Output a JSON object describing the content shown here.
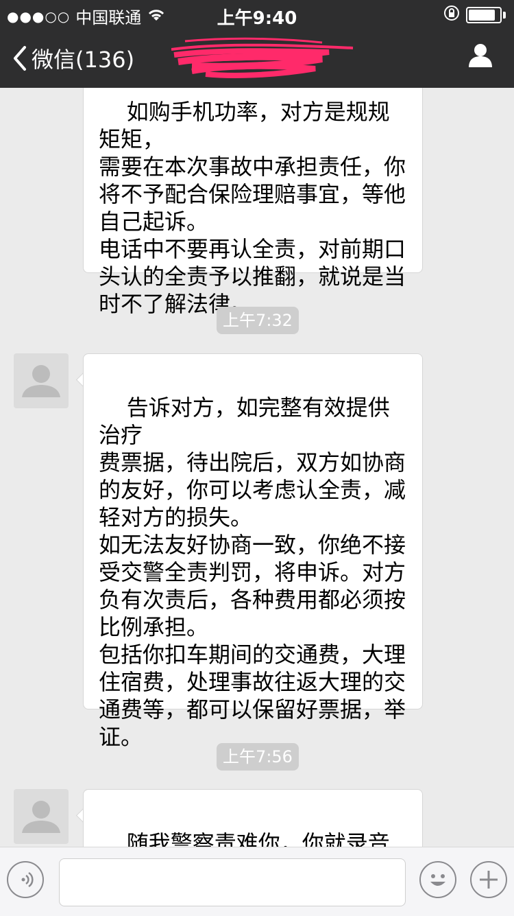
{
  "status_bar": {
    "signal": "●●●○○",
    "carrier": "中国联通",
    "time": "上午9:40"
  },
  "nav": {
    "back_label": "微信(136)",
    "title": "",
    "title_redacted": true
  },
  "messages": {
    "first": {
      "text": "如购手机功率，对方是规规矩矩，\n需要在本次事故中承担责任，你\n将不予配合保险理赔事宜，等他\n自己起诉。\n电话中不要再认全责，对前期口\n头认的全责予以推翻，就说是当\n时不了解法律。"
    },
    "ts1": "上午7:32",
    "second": {
      "text": "告诉对方，如完整有效提供治疗\n费票据，待出院后，双方如协商\n的友好，你可以考虑认全责，减\n轻对方的损失。\n如无法友好协商一致，你绝不接\n受交警全责判罚，将申诉。对方\n负有次责后，各种费用都必须按\n比例承担。\n包括你扣车期间的交通费，大理\n住宿费，处理事故往返大理的交\n通费等，都可以保留好票据，举\n证。"
    },
    "ts2": "上午7:56",
    "third": {
      "text": "随我警察责难你，你就录音问警\n察"
    }
  },
  "icons": {
    "back": "chevron-left-icon",
    "profile": "person-icon",
    "voice": "voice-icon",
    "emoji": "emoji-icon",
    "add": "plus-icon",
    "wifi": "wifi-icon",
    "lock": "rotation-lock-icon",
    "battery": "battery-icon"
  },
  "battery_level": 0.95,
  "colors": {
    "header_bg": "#2e2e2f",
    "chat_bg": "#ebebeb",
    "timestamp_bg": "#cecece",
    "redaction": "#ff2a6a"
  }
}
